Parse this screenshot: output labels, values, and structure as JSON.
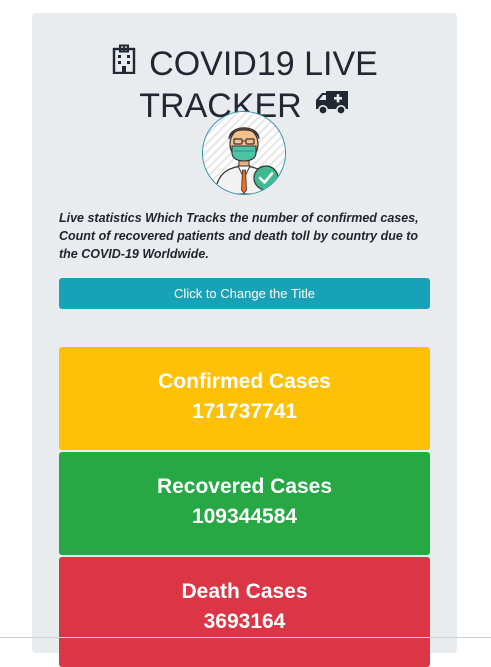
{
  "header": {
    "title_line1": "COVID19 LIVE",
    "title_line2": "TRACKER",
    "title_icon_left": "hospital-icon",
    "title_icon_right": "ambulance-icon"
  },
  "avatar": {
    "icon": "masked-doctor-avatar"
  },
  "description": "Live statistics Which Tracks the number of confirmed cases, Count of recovered patients and death toll by country due to the COVID-19 Worldwide.",
  "change_title_button": "Click to Change the Title",
  "cards": {
    "confirmed": {
      "label": "Confirmed Cases",
      "value": "171737741",
      "color": "#ffc107"
    },
    "recovered": {
      "label": "Recovered Cases",
      "value": "109344584",
      "color": "#28a745"
    },
    "death": {
      "label": "Death Cases",
      "value": "3693164",
      "color": "#dc3545"
    }
  },
  "colors": {
    "panel_bg": "#e9ecef",
    "button_bg": "#17a2b8"
  }
}
